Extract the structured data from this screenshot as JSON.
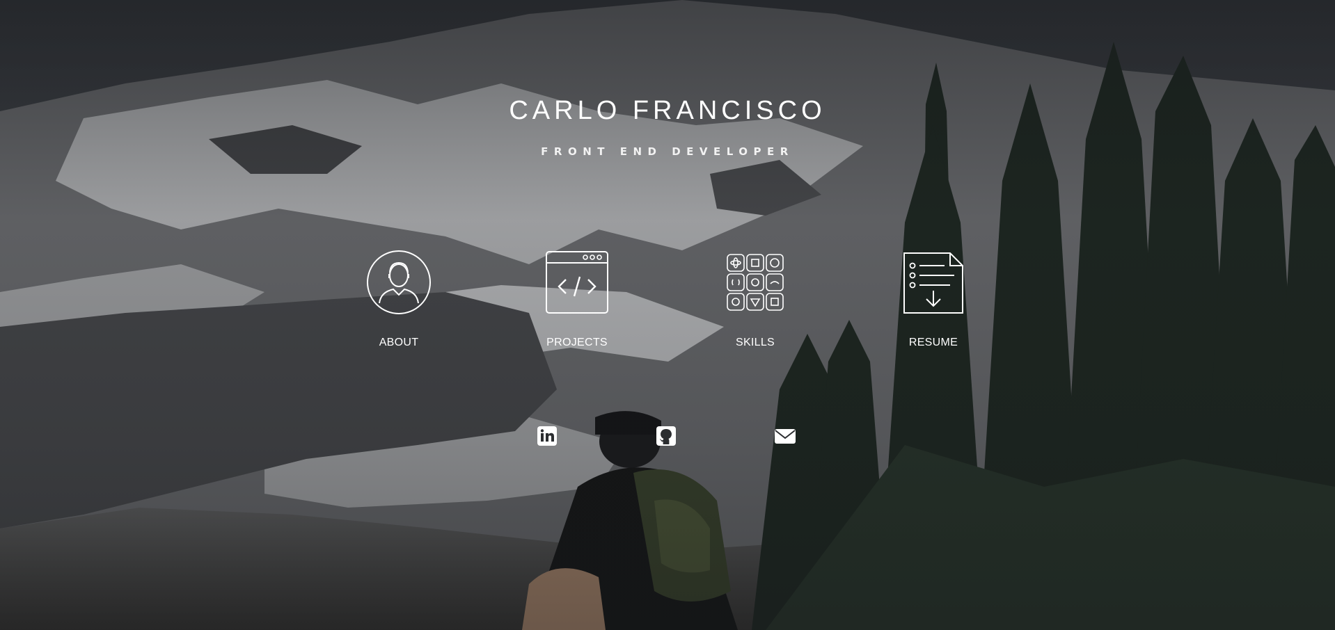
{
  "hero": {
    "name": "CARLO FRANCISCO",
    "role": "FRONT END DEVELOPER"
  },
  "nav": [
    {
      "label": "ABOUT",
      "icon": "user-avatar-icon"
    },
    {
      "label": "PROJECTS",
      "icon": "code-window-icon"
    },
    {
      "label": "SKILLS",
      "icon": "skills-grid-icon"
    },
    {
      "label": "RESUME",
      "icon": "resume-download-icon"
    }
  ],
  "social": [
    {
      "icon": "linkedin-icon"
    },
    {
      "icon": "github-icon"
    },
    {
      "icon": "email-icon"
    }
  ],
  "colors": {
    "text": "#ffffff",
    "overlay": "#14161a"
  }
}
